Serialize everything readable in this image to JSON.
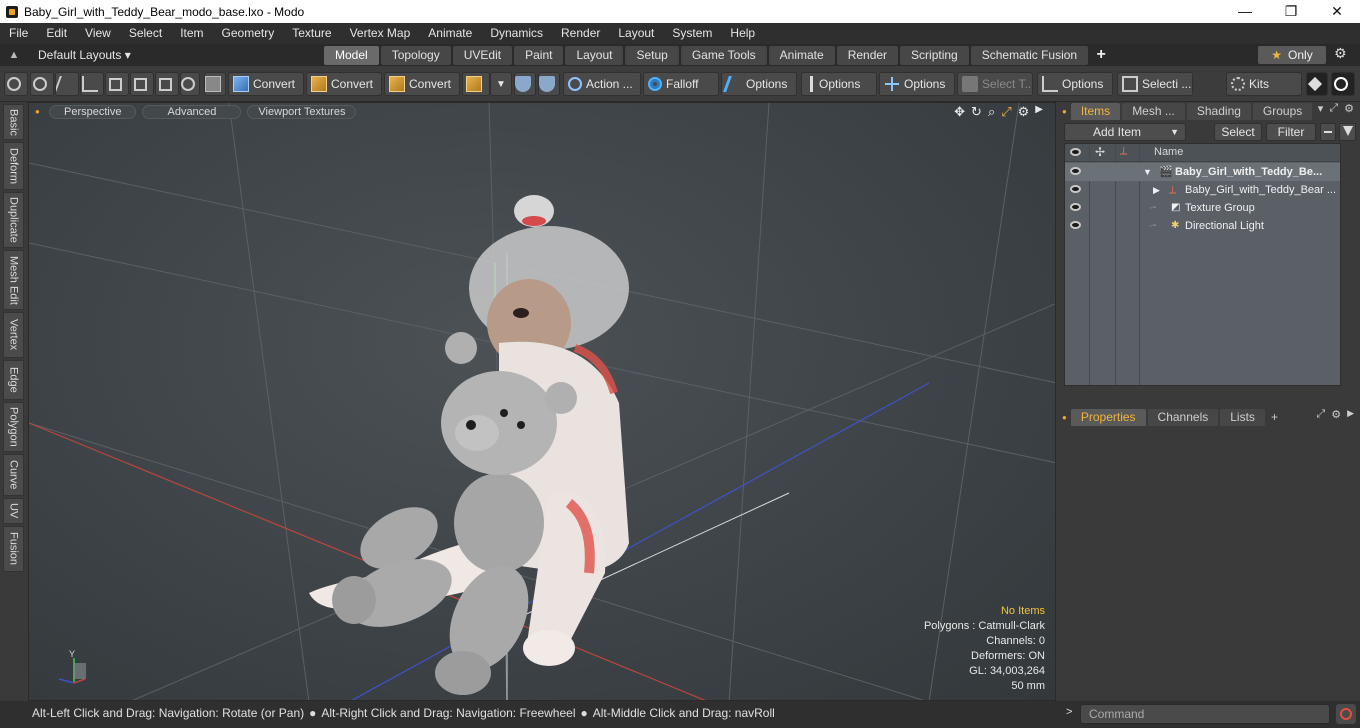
{
  "window": {
    "title": "Baby_Girl_with_Teddy_Bear_modo_base.lxo - Modo",
    "minimize": "—",
    "maximize": "❐",
    "close": "✕"
  },
  "menu": [
    "File",
    "Edit",
    "View",
    "Select",
    "Item",
    "Geometry",
    "Texture",
    "Vertex Map",
    "Animate",
    "Dynamics",
    "Render",
    "Layout",
    "System",
    "Help"
  ],
  "layout_bar": {
    "layout_dropdown": "Default Layouts ▾",
    "tabs": [
      "Model",
      "Topology",
      "UVEdit",
      "Paint",
      "Layout",
      "Setup",
      "Game Tools",
      "Animate",
      "Render",
      "Scripting",
      "Schematic Fusion"
    ],
    "active_tab": "Model",
    "add": "+",
    "only": "Only",
    "star": "★",
    "gear": "⚙"
  },
  "toolbar": {
    "convert1": "Convert",
    "convert2": "Convert",
    "convert3": "Convert",
    "action": "Action  ...",
    "falloff": "Falloff",
    "options1": "Options",
    "options2": "Options",
    "options3": "Options",
    "select_t": "Select T...",
    "options4": "Options",
    "selecti": "Selecti ...",
    "kits": "Kits"
  },
  "left_tabs": [
    "Basic",
    "Deform",
    "Duplicate",
    "Mesh Edit",
    "Vertex",
    "Edge",
    "Polygon",
    "Curve",
    "UV",
    "Fusion"
  ],
  "viewport": {
    "view_mode": "Perspective",
    "advanced": "Advanced",
    "textures": "Viewport Textures",
    "info": {
      "selection": "No Items",
      "polygons": "Polygons : Catmull-Clark",
      "channels": "Channels: 0",
      "deformers": "Deformers: ON",
      "gl": "GL: 34,003,264",
      "focal": "50 mm"
    },
    "axis_y": "Y"
  },
  "statusbar": {
    "hint1": "Alt-Left Click and Drag: Navigation: Rotate (or Pan)",
    "hint2": "Alt-Right Click and Drag: Navigation: Freewheel",
    "hint3": "Alt-Middle Click and Drag: navRoll",
    "sep": "●"
  },
  "items_panel": {
    "tabs": [
      "Items",
      "Mesh ...",
      "Shading",
      "Groups"
    ],
    "active_tab": "Items",
    "add_item": "Add Item",
    "select": "Select",
    "filter": "Filter",
    "name_header": "Name",
    "rows": [
      {
        "label": "Baby_Girl_with_Teddy_Be..."
      },
      {
        "label": "Baby_Girl_with_Teddy_Bear ..."
      },
      {
        "label": "Texture Group"
      },
      {
        "label": "Directional Light"
      }
    ]
  },
  "properties_panel": {
    "tabs": [
      "Properties",
      "Channels",
      "Lists"
    ],
    "active_tab": "Properties",
    "add": "+"
  },
  "command": {
    "placeholder": "Command"
  }
}
